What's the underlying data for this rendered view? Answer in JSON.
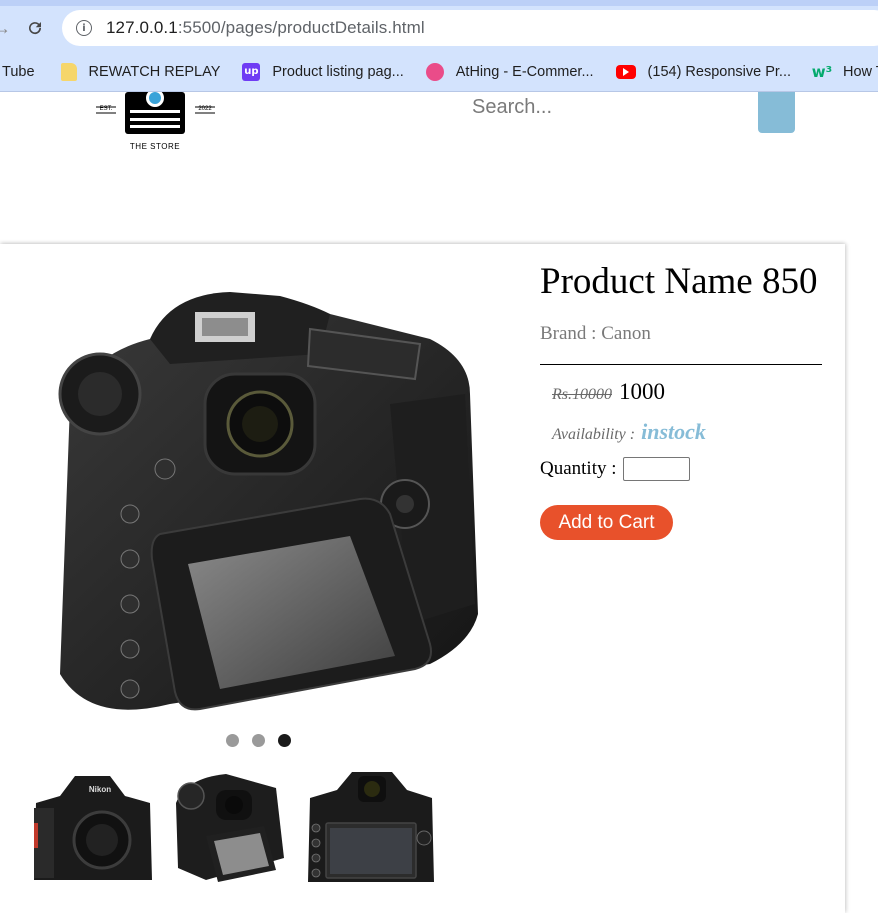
{
  "browser": {
    "url_host": "127.0.0.1",
    "url_path": ":5500/pages/productDetails.html",
    "bookmarks": [
      {
        "label": "Tube",
        "icon": "youtube-tube"
      },
      {
        "label": "REWATCH REPLAY",
        "icon": "folder-icon"
      },
      {
        "label": "Product listing pag...",
        "icon": "up-icon"
      },
      {
        "label": "AtHing - E-Commer...",
        "icon": "dribbble-icon"
      },
      {
        "label": "(154) Responsive Pr...",
        "icon": "youtube-icon"
      },
      {
        "label": "How To",
        "icon": "w3schools-icon"
      }
    ],
    "up_icon_text": "up",
    "w3_icon_text": "w³"
  },
  "header": {
    "logo_est": "EST.",
    "logo_year": "2022",
    "logo_caption": "THE STORE",
    "search_placeholder": "Search..."
  },
  "product": {
    "name": "Product Name 850",
    "brand": "Brand : Canon",
    "old_price": "Rs.10000",
    "price": "1000",
    "availability_label": "Availability :",
    "availability_value": "instock",
    "quantity_label": "Quantity :",
    "add_to_cart": "Add to Cart",
    "thumb_brand_text": "Nikon",
    "carousel": {
      "count": 3,
      "active": 3
    }
  },
  "colors": {
    "accent": "#86bcd7",
    "cart_button": "#e8512b",
    "browser_frame": "#d3e3fd"
  }
}
